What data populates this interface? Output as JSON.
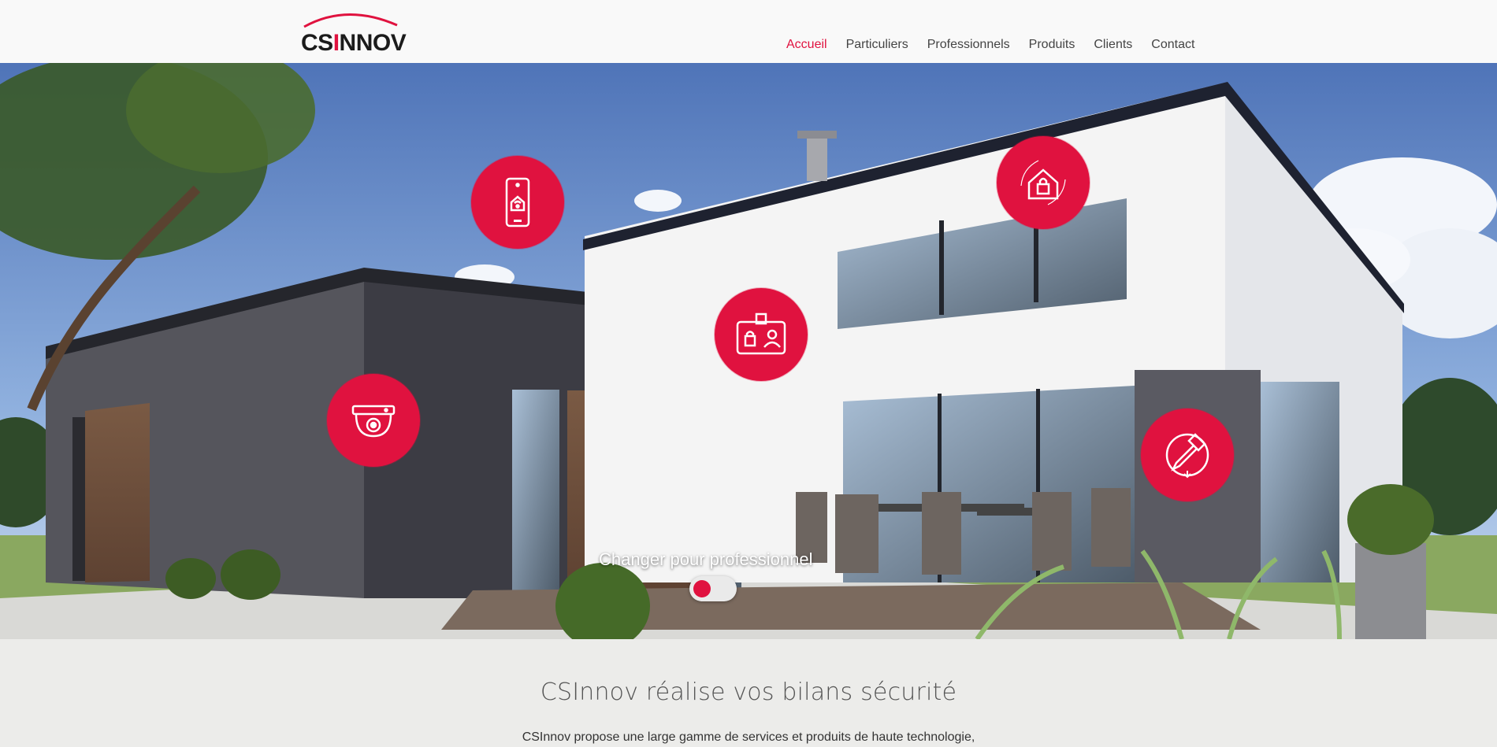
{
  "brand": {
    "logo_prefix": "CS",
    "logo_accent": "I",
    "logo_suffix": "NNOV",
    "accent_color": "#e0123f"
  },
  "nav": {
    "items": [
      {
        "label": "Accueil",
        "active": true
      },
      {
        "label": "Particuliers",
        "active": false
      },
      {
        "label": "Professionnels",
        "active": false
      },
      {
        "label": "Produits",
        "active": false
      },
      {
        "label": "Clients",
        "active": false
      },
      {
        "label": "Contact",
        "active": false
      }
    ]
  },
  "hero": {
    "badges": [
      {
        "icon": "smartphone-home-wifi-icon"
      },
      {
        "icon": "home-lock-icon"
      },
      {
        "icon": "id-badge-lock-icon"
      },
      {
        "icon": "dome-camera-icon"
      },
      {
        "icon": "screwdriver-install-icon"
      }
    ],
    "switch_label": "Changer pour professionnel",
    "switch_on": false
  },
  "intro": {
    "title": "CSInnov réalise vos bilans sécurité",
    "text": "CSInnov propose une large gamme de services et produits de haute technologie,"
  }
}
